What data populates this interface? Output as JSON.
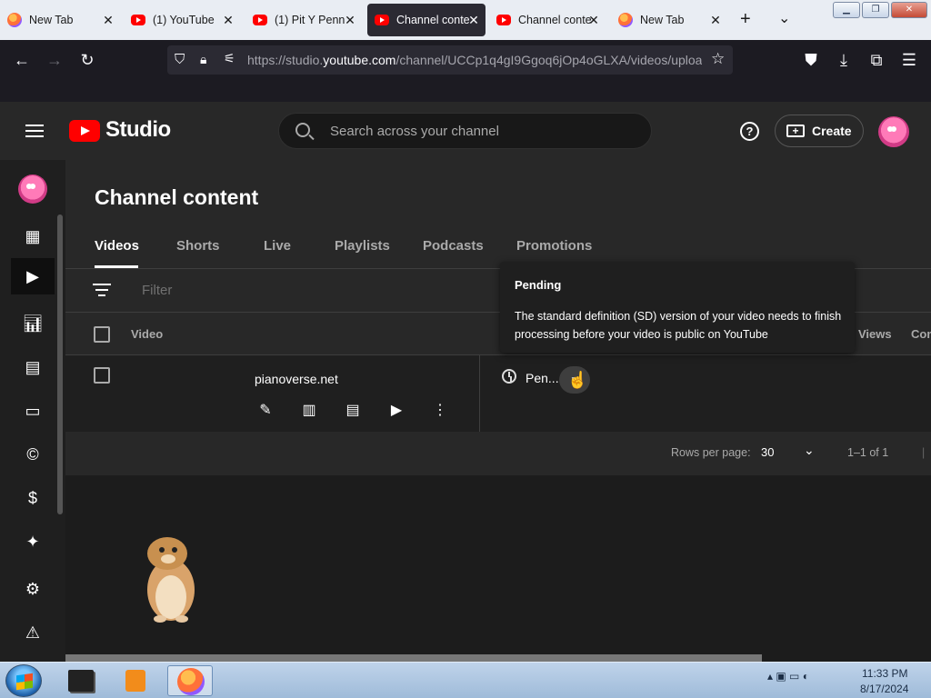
{
  "browser": {
    "tabs": [
      {
        "label": "New Tab",
        "favicon": "firefox-icon"
      },
      {
        "label": "(1) YouTube",
        "favicon": "youtube-icon"
      },
      {
        "label": "(1) Pit Y Penn",
        "favicon": "youtube-icon"
      },
      {
        "label": "Channel conte",
        "favicon": "youtube-icon",
        "active": true
      },
      {
        "label": "Channel conte",
        "favicon": "youtube-icon"
      },
      {
        "label": "New Tab",
        "favicon": "firefox-icon"
      }
    ],
    "new_tab_glyph": "+",
    "tab_list_glyph": "⌄",
    "url_prefix": "https://studio.",
    "url_domain": "youtube.com",
    "url_rest": "/channel/UCCp1q4gI9Ggoq6jOp4oGLXA/videos/uploa"
  },
  "studio": {
    "logo_text": "Studio",
    "search_placeholder": "Search across your channel",
    "help_glyph": "?",
    "create_label": "Create",
    "page_title": "Channel content",
    "tabs": [
      "Videos",
      "Shorts",
      "Live",
      "Playlists",
      "Podcasts",
      "Promotions"
    ],
    "filter_placeholder": "Filter",
    "columns": {
      "video": "Video",
      "views": "Views",
      "comments": "Com"
    },
    "row": {
      "title": "pianoverse.net",
      "status": "Pen..."
    },
    "pager": {
      "rows_label": "Rows per page:",
      "rows_value": "30",
      "range": "1–1 of 1",
      "separator": "|"
    },
    "tooltip": {
      "title": "Pending",
      "body": "The standard definition (SD) version of your video needs to finish processing before your video is public on YouTube"
    }
  },
  "taskbar": {
    "time": "11:33 PM",
    "date": "8/17/2024"
  },
  "colors": {
    "accent": "#ff0000",
    "bg": "#282828"
  }
}
